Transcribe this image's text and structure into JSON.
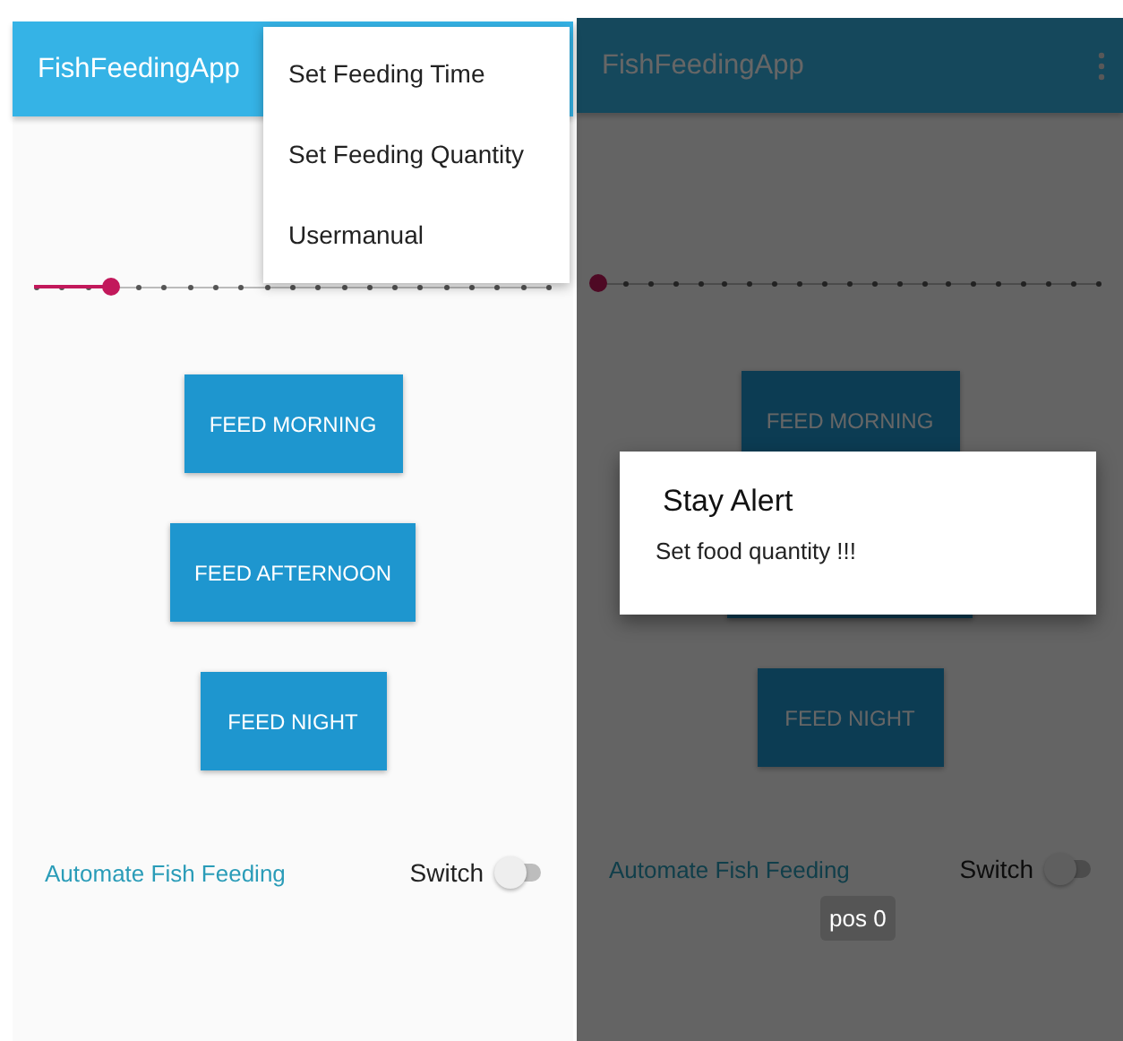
{
  "screens": [
    {
      "title": "FishFeedingApp",
      "dimmed": false,
      "menu": {
        "items": [
          "Set Feeding Time",
          "Set Feeding Quantity",
          "Usermanual"
        ]
      },
      "slider": {
        "level": 0.15
      },
      "buttons": [
        {
          "label": "FEED MORNING"
        },
        {
          "label": "FEED AFTERNOON"
        },
        {
          "label": "FEED NIGHT"
        }
      ],
      "automate_label": "Automate Fish Feeding",
      "switch": {
        "label": "Switch",
        "on": false
      }
    },
    {
      "title": "FishFeedingApp",
      "dimmed": true,
      "slider": {
        "level": 0
      },
      "buttons": [
        {
          "label": "FEED MORNING"
        },
        {
          "covered": true
        },
        {
          "label": "FEED NIGHT"
        }
      ],
      "automate_label": "Automate Fish Feeding",
      "switch": {
        "label": "Switch",
        "on": false
      },
      "dialog": {
        "title": "Stay Alert",
        "message": "Set food quantity !!!"
      },
      "toast": "pos 0"
    }
  ]
}
